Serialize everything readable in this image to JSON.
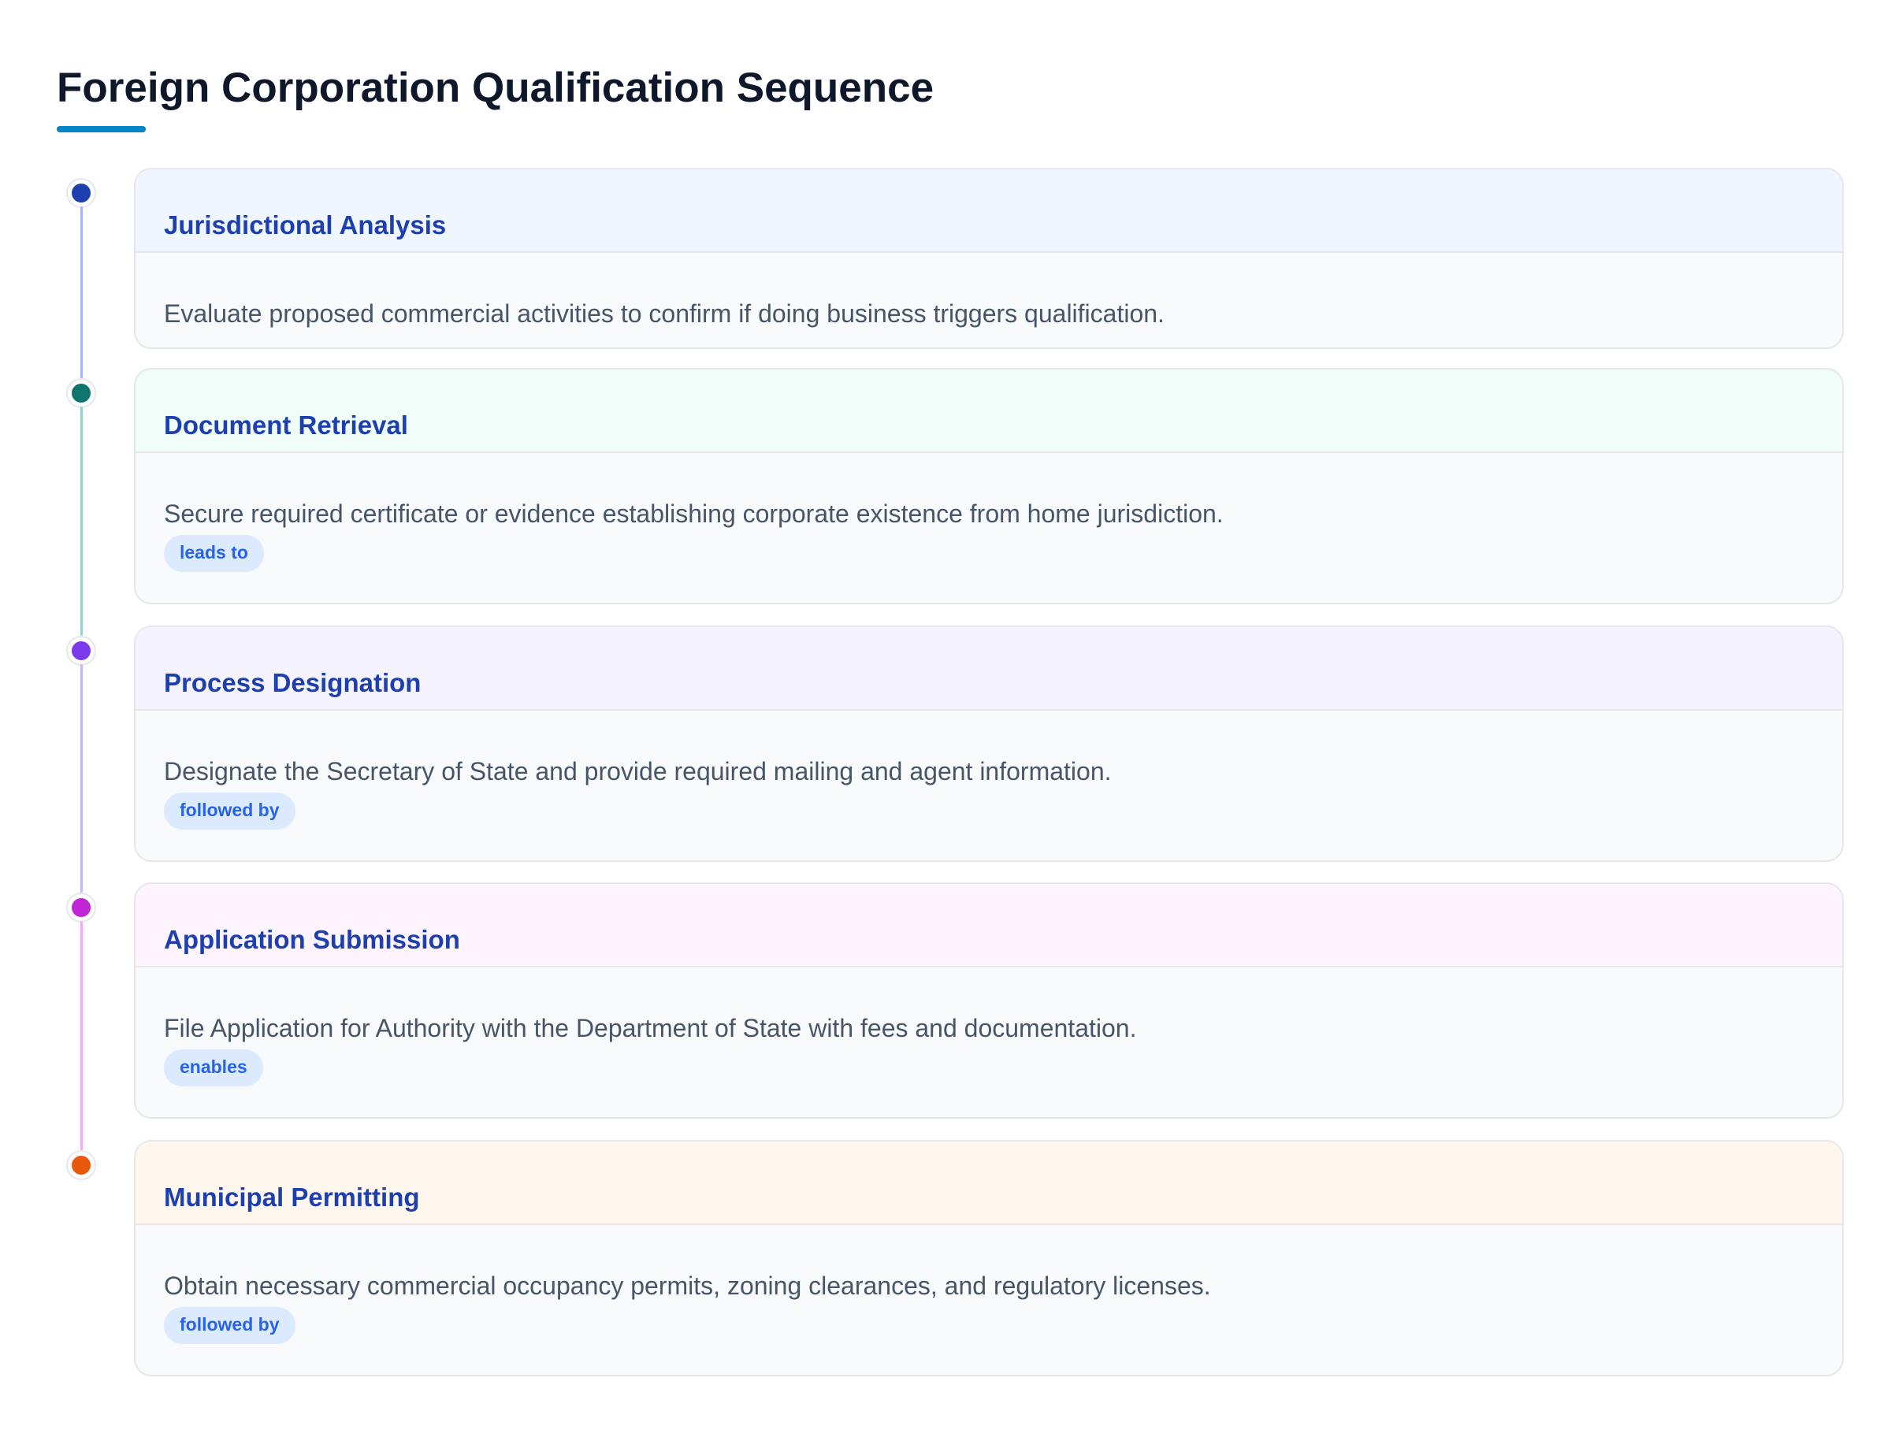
{
  "title": "Foreign Corporation Qualification Sequence",
  "colors": {
    "accent": "#0284c7",
    "step_title": "#1e40af",
    "badge_bg": "#dbeafe",
    "badge_text": "#2563eb"
  },
  "steps": [
    {
      "title": "Jurisdictional Analysis",
      "description": "Evaluate proposed commercial activities to confirm if doing business triggers qualification.",
      "badge": "",
      "dot_color": "#1e40af",
      "line_color": "#a5b4fc",
      "header_bg": "#eff6ff"
    },
    {
      "title": "Document Retrieval",
      "description": "Secure required certificate or evidence establishing corporate existence from home jurisdiction.",
      "badge": "leads to",
      "dot_color": "#0f766e",
      "line_color": "#99d1c6",
      "header_bg": "#f0fdf9"
    },
    {
      "title": "Process Designation",
      "description": "Designate the Secretary of State and provide required mailing and agent information.",
      "badge": "followed by",
      "dot_color": "#7c3aed",
      "line_color": "#c4b5fd",
      "header_bg": "#f5f3ff"
    },
    {
      "title": "Application Submission",
      "description": "File Application for Authority with the Department of State with fees and documentation.",
      "badge": "enables",
      "dot_color": "#c026d3",
      "line_color": "#f0abfc",
      "header_bg": "#fdf4ff"
    },
    {
      "title": "Municipal Permitting",
      "description": "Obtain necessary commercial occupancy permits, zoning clearances, and regulatory licenses.",
      "badge": "followed by",
      "dot_color": "#ea580c",
      "line_color": "",
      "header_bg": "#fff7ed"
    }
  ]
}
